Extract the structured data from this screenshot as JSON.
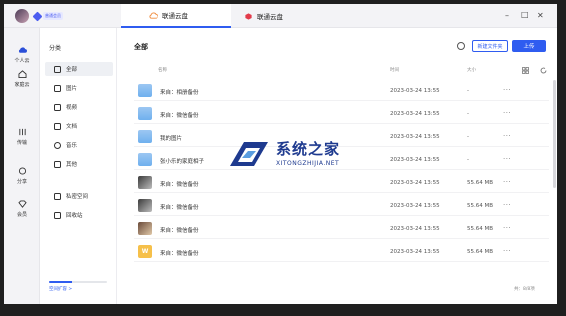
{
  "colors": {
    "accent": "#2f5cf0",
    "folder": "#7ab6f0"
  },
  "topbar": {
    "tabs": [
      {
        "label": "联通云盘",
        "active": true,
        "icon": "cloud-icon"
      },
      {
        "label": "联通云盘",
        "active": false,
        "icon": "cube-icon"
      }
    ],
    "vip_label": "普通会员"
  },
  "leftnav": [
    {
      "label": "个人云",
      "icon": "cloud-icon"
    },
    {
      "label": "家庭云",
      "icon": "home-icon"
    },
    {
      "label": "传输",
      "icon": "transfer-icon"
    },
    {
      "label": "分享",
      "icon": "share-icon"
    },
    {
      "label": "会员",
      "icon": "diamond-icon"
    }
  ],
  "categories": {
    "heading": "分类",
    "items": [
      "全部",
      "图片",
      "视频",
      "文档",
      "音乐",
      "其他"
    ],
    "extra": [
      "私密空间",
      "回收站"
    ],
    "storage_link": "空间扩容 >",
    "storage_usage": 0.4
  },
  "main": {
    "title": "全部",
    "new_folder_label": "新建文件夹",
    "upload_label": "上传",
    "columns": {
      "name": "名称",
      "date": "时间",
      "size": "大小"
    },
    "total_label": "共：8/8项"
  },
  "files": [
    {
      "name": "来自：相册备份",
      "date": "2023-03-24 13:55",
      "size": "-",
      "type": "folder"
    },
    {
      "name": "来自：微信备份",
      "date": "2023-03-24 13:55",
      "size": "-",
      "type": "folder"
    },
    {
      "name": "我的图片",
      "date": "2023-03-24 13:55",
      "size": "-",
      "type": "folder"
    },
    {
      "name": "张小乐的家庭相子",
      "date": "2023-03-24 13:55",
      "size": "-",
      "type": "folder"
    },
    {
      "name": "来自：微信备份",
      "date": "2023-03-24 13:55",
      "size": "55.64 MB",
      "type": "photo"
    },
    {
      "name": "来自：微信备份",
      "date": "2023-03-24 13:55",
      "size": "55.64 MB",
      "type": "photo"
    },
    {
      "name": "来自：微信备份",
      "date": "2023-03-24 13:55",
      "size": "55.64 MB",
      "type": "photo2"
    },
    {
      "name": "来自：微信备份",
      "date": "2023-03-24 13:55",
      "size": "55.64 MB",
      "type": "doc"
    }
  ],
  "watermark": {
    "title": "系统之家",
    "url": "XITONGZHIJIA.NET"
  }
}
